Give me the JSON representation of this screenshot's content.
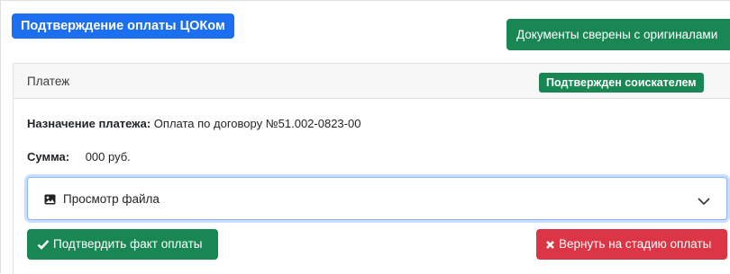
{
  "header": {
    "title": "Подтверждение оплаты ЦОКом",
    "docs_button": "Документы сверены с оригиналами"
  },
  "payment_card": {
    "header_label": "Платеж",
    "status_badge": "Подтвержден соискателем",
    "purpose_label": "Назначение платежа:",
    "purpose_value": "Оплата по договору №51.002-0823-00",
    "sum_label": "Сумма:",
    "sum_value": "000 руб.",
    "file_viewer": {
      "icon": "image-icon",
      "label": "Просмотр файла",
      "toggle_icon": "chevron-down-icon"
    },
    "confirm_button": {
      "icon": "check-icon",
      "label": "Подтвердить факт оплаты"
    },
    "return_button": {
      "icon": "close-icon",
      "label": "Вернуть на стадию оплаты"
    }
  },
  "colors": {
    "primary": "#1d6ff2",
    "success": "#198754",
    "danger": "#dc3545"
  }
}
